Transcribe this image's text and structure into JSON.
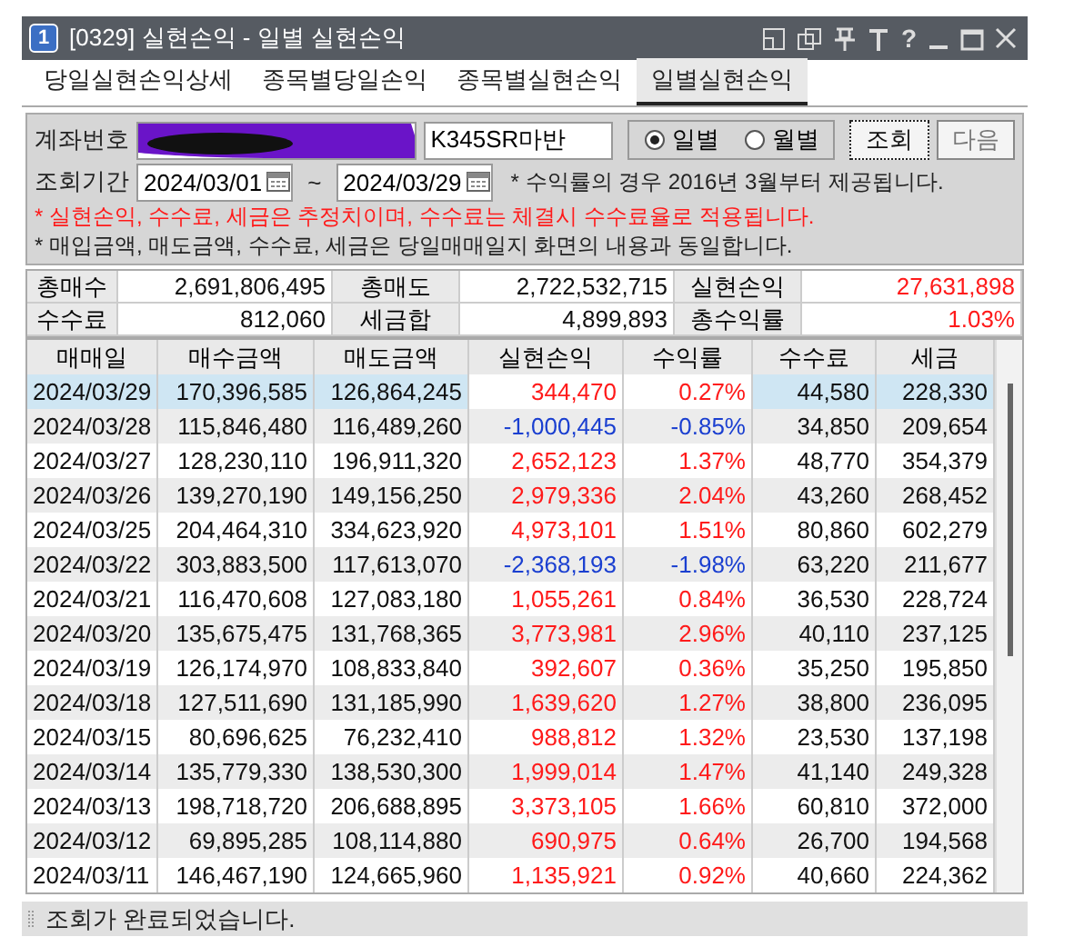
{
  "window": {
    "number": "1",
    "title": "[0329] 실현손익 - 일별 실현손익",
    "title_buttons": [
      "?"
    ]
  },
  "tabs": [
    {
      "label": "당일실현손익상세",
      "selected": false
    },
    {
      "label": "종목별당일손익",
      "selected": false
    },
    {
      "label": "종목별실현손익",
      "selected": false
    },
    {
      "label": "일별실현손익",
      "selected": true
    }
  ],
  "form": {
    "account_label": "계좌번호",
    "account_name": "K345SR마반",
    "period_options": [
      {
        "label": "일별",
        "selected": true
      },
      {
        "label": "월별",
        "selected": false
      }
    ],
    "query_button": "조회",
    "next_button": "다음",
    "period_label": "조회기간",
    "date_from": "2024/03/01",
    "date_separator": "~",
    "date_to": "2024/03/29",
    "notes": [
      {
        "text": "* 수익률의 경우 2016년 3월부터 제공됩니다.",
        "kind": "info"
      },
      {
        "text": "* 실현손익, 수수료, 세금은 추정치이며, 수수료는 체결시 수수료율로 적용됩니다.",
        "kind": "warning"
      },
      {
        "text": "* 매입금액, 매도금액, 수수료, 세금은 당일매매일지 화면의 내용과 동일합니다.",
        "kind": "info"
      }
    ]
  },
  "summary": [
    [
      {
        "label": "총매수",
        "value": "2,691,806,495",
        "kind": "plain"
      },
      {
        "label": "총매도",
        "value": "2,722,532,715",
        "kind": "plain"
      },
      {
        "label": "실현손익",
        "value": "27,631,898",
        "kind": "gain"
      }
    ],
    [
      {
        "label": "수수료",
        "value": "812,060",
        "kind": "plain"
      },
      {
        "label": "세금합",
        "value": "4,899,893",
        "kind": "plain"
      },
      {
        "label": "총수익률",
        "value": "1.03%",
        "kind": "gain"
      }
    ]
  ],
  "table": {
    "columns": [
      "매매일",
      "매수금액",
      "매도금액",
      "실현손익",
      "수익률",
      "수수료",
      "세금"
    ],
    "rows": [
      {
        "cells": [
          "2024/03/29",
          "170,396,585",
          "126,864,245",
          "344,470",
          "0.27%",
          "44,580",
          "228,330"
        ],
        "kind": "gain",
        "selected": true
      },
      {
        "cells": [
          "2024/03/28",
          "115,846,480",
          "116,489,260",
          "-1,000,445",
          "-0.85%",
          "34,850",
          "209,654"
        ],
        "kind": "loss",
        "selected": false
      },
      {
        "cells": [
          "2024/03/27",
          "128,230,110",
          "196,911,320",
          "2,652,123",
          "1.37%",
          "48,770",
          "354,379"
        ],
        "kind": "gain",
        "selected": false
      },
      {
        "cells": [
          "2024/03/26",
          "139,270,190",
          "149,156,250",
          "2,979,336",
          "2.04%",
          "43,260",
          "268,452"
        ],
        "kind": "gain",
        "selected": false
      },
      {
        "cells": [
          "2024/03/25",
          "204,464,310",
          "334,623,920",
          "4,973,101",
          "1.51%",
          "80,860",
          "602,279"
        ],
        "kind": "gain",
        "selected": false
      },
      {
        "cells": [
          "2024/03/22",
          "303,883,500",
          "117,613,070",
          "-2,368,193",
          "-1.98%",
          "63,220",
          "211,677"
        ],
        "kind": "loss",
        "selected": false
      },
      {
        "cells": [
          "2024/03/21",
          "116,470,608",
          "127,083,180",
          "1,055,261",
          "0.84%",
          "36,530",
          "228,724"
        ],
        "kind": "gain",
        "selected": false
      },
      {
        "cells": [
          "2024/03/20",
          "135,675,475",
          "131,768,365",
          "3,773,981",
          "2.96%",
          "40,110",
          "237,125"
        ],
        "kind": "gain",
        "selected": false
      },
      {
        "cells": [
          "2024/03/19",
          "126,174,970",
          "108,833,840",
          "392,607",
          "0.36%",
          "35,250",
          "195,850"
        ],
        "kind": "gain",
        "selected": false
      },
      {
        "cells": [
          "2024/03/18",
          "127,511,690",
          "131,185,990",
          "1,639,620",
          "1.27%",
          "38,800",
          "236,095"
        ],
        "kind": "gain",
        "selected": false
      },
      {
        "cells": [
          "2024/03/15",
          "80,696,625",
          "76,232,410",
          "988,812",
          "1.32%",
          "23,530",
          "137,198"
        ],
        "kind": "gain",
        "selected": false
      },
      {
        "cells": [
          "2024/03/14",
          "135,779,330",
          "138,530,300",
          "1,999,014",
          "1.47%",
          "41,140",
          "249,328"
        ],
        "kind": "gain",
        "selected": false
      },
      {
        "cells": [
          "2024/03/13",
          "198,718,720",
          "206,688,895",
          "3,373,105",
          "1.66%",
          "60,810",
          "372,000"
        ],
        "kind": "gain",
        "selected": false
      },
      {
        "cells": [
          "2024/03/12",
          "69,895,285",
          "108,114,880",
          "690,975",
          "0.64%",
          "26,700",
          "194,568"
        ],
        "kind": "gain",
        "selected": false
      },
      {
        "cells": [
          "2024/03/11",
          "146,467,190",
          "124,665,960",
          "1,135,921",
          "0.92%",
          "40,660",
          "224,362"
        ],
        "kind": "gain",
        "selected": false
      }
    ]
  },
  "status_bar": "조회가 완료되었습니다."
}
